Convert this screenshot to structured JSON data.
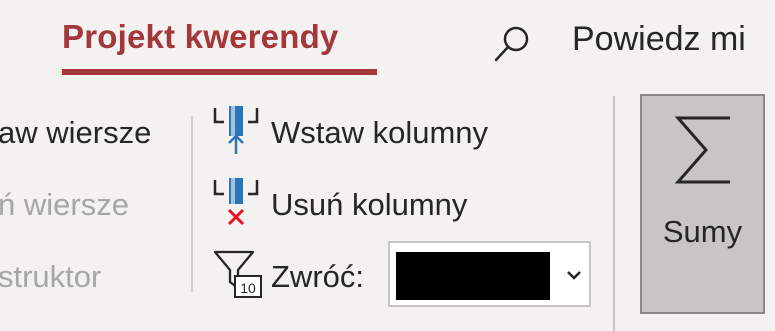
{
  "tab": {
    "label": "Projekt kwerendy"
  },
  "tell_me": {
    "text": "Powiedz mi"
  },
  "rows": {
    "insert_rows_label": "aw wiersze",
    "delete_rows_label": "ń wiersze",
    "builder_label": "struktor"
  },
  "columns": {
    "insert_label": "Wstaw kolumny",
    "delete_label": "Usuń kolumny"
  },
  "return": {
    "label": "Zwróć:",
    "value": ""
  },
  "totals": {
    "label": "Sumy"
  },
  "icons": {
    "search": "search-icon",
    "insert_columns": "insert-columns-icon",
    "delete_columns": "delete-columns-icon",
    "return_filter": "top-values-filter-icon",
    "chevron": "chevron-down-icon",
    "sigma": "sigma-icon"
  },
  "colors": {
    "accent": "#a4373a",
    "ribbon_bg": "#f3f2f1",
    "column_blue": "#2e75b6",
    "delete_red": "#e81123",
    "pressed_button": "#c8c6c4"
  }
}
